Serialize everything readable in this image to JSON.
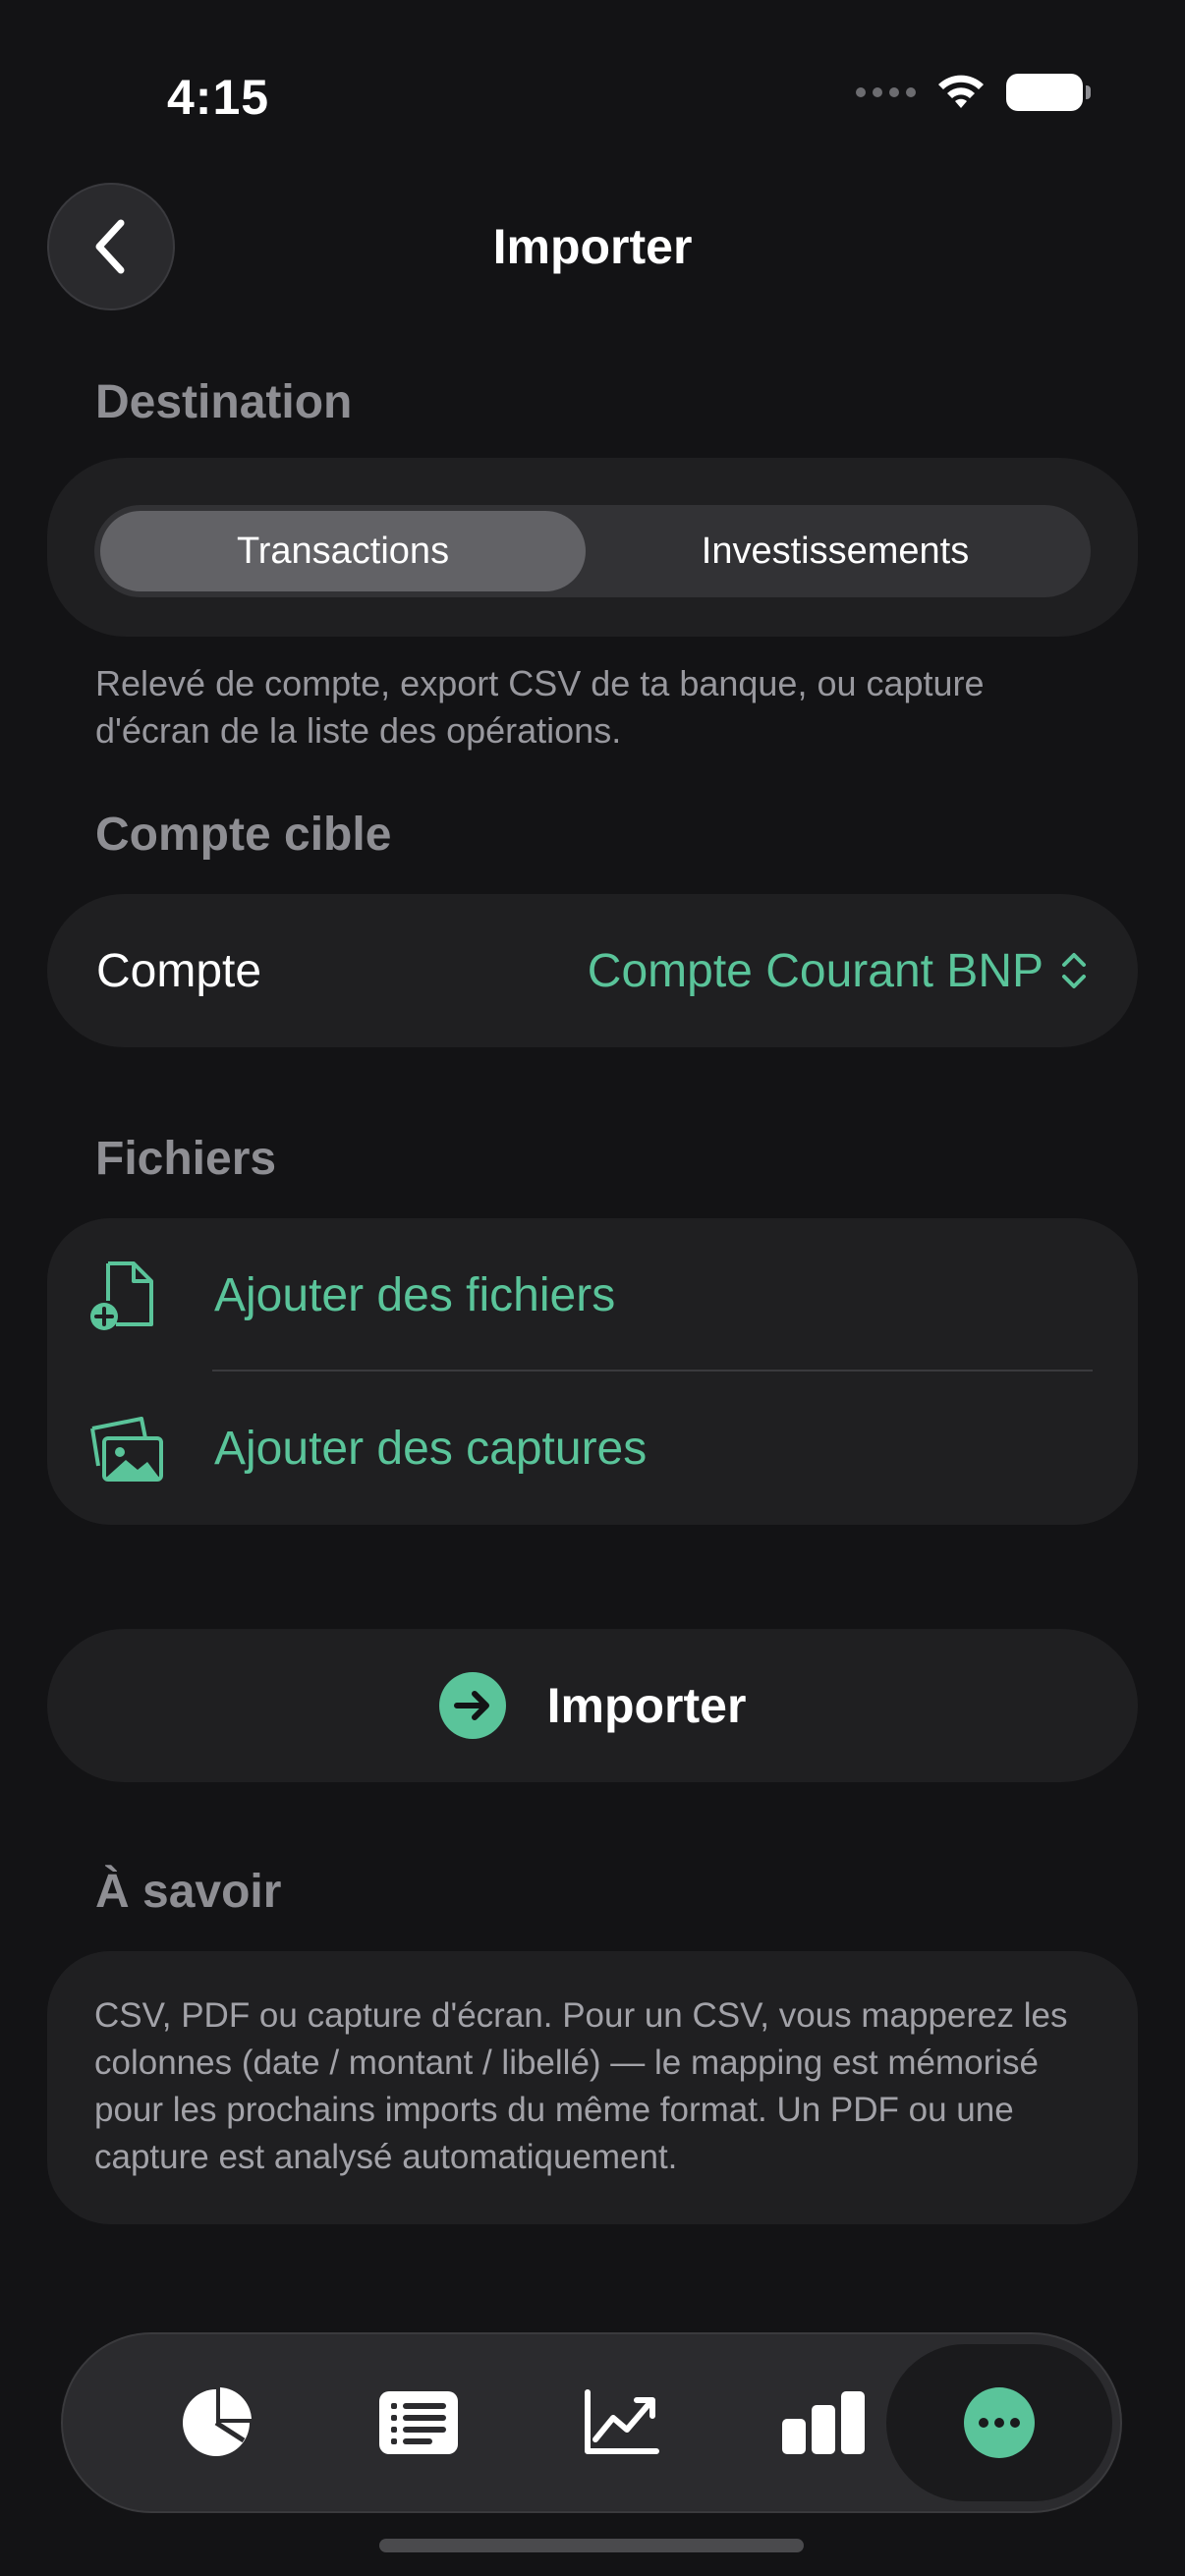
{
  "status_bar": {
    "time": "4:15"
  },
  "nav": {
    "title": "Importer"
  },
  "destination": {
    "header": "Destination",
    "options": [
      "Transactions",
      "Investissements"
    ],
    "selected": "Transactions",
    "helper": "Relevé de compte, export CSV de ta banque, ou capture d'écran de la liste des opérations."
  },
  "target": {
    "header": "Compte cible",
    "label": "Compte",
    "value": "Compte Courant BNP"
  },
  "files": {
    "header": "Fichiers",
    "add_files": "Ajouter des fichiers",
    "add_captures": "Ajouter des captures"
  },
  "import_button": {
    "label": "Importer"
  },
  "info": {
    "header": "À savoir",
    "text": "CSV, PDF ou capture d'écran. Pour un CSV, vous mapperez les colonnes (date / montant / libellé) — le mapping est mémorisé pour les prochains imports du même format. Un PDF ou une capture est analysé automatiquement."
  },
  "tab_bar": {
    "tabs": [
      "pie-chart-icon",
      "list-icon",
      "trend-icon",
      "bar-chart-icon",
      "more-icon"
    ],
    "selected": "more-icon"
  },
  "colors": {
    "accent": "#5ac49a",
    "background": "#131315",
    "card": "#1f1f21"
  }
}
